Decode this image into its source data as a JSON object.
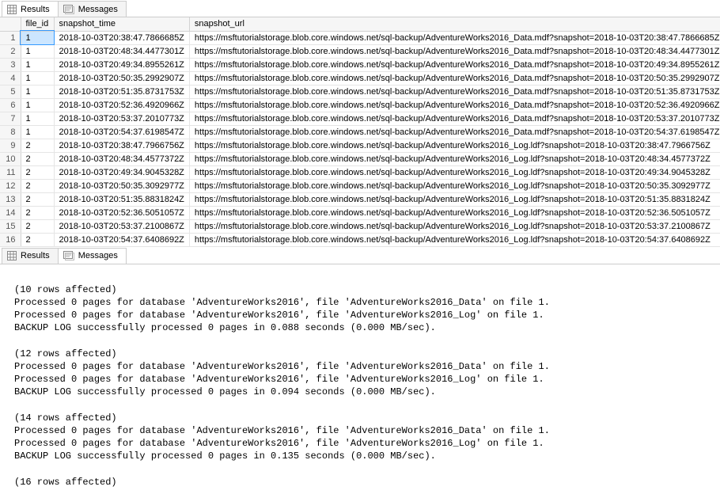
{
  "tabs_top": {
    "results": "Results",
    "messages": "Messages"
  },
  "tabs_bottom": {
    "results": "Results",
    "messages": "Messages"
  },
  "columns": {
    "file_id": "file_id",
    "snapshot_time": "snapshot_time",
    "snapshot_url": "snapshot_url"
  },
  "rows": [
    {
      "n": "1",
      "file_id": "1",
      "snapshot_time": "2018-10-03T20:38:47.7866685Z",
      "snapshot_url": "https://msftutorialstorage.blob.core.windows.net/sql-backup/AdventureWorks2016_Data.mdf?snapshot=2018-10-03T20:38:47.7866685Z"
    },
    {
      "n": "2",
      "file_id": "1",
      "snapshot_time": "2018-10-03T20:48:34.4477301Z",
      "snapshot_url": "https://msftutorialstorage.blob.core.windows.net/sql-backup/AdventureWorks2016_Data.mdf?snapshot=2018-10-03T20:48:34.4477301Z"
    },
    {
      "n": "3",
      "file_id": "1",
      "snapshot_time": "2018-10-03T20:49:34.8955261Z",
      "snapshot_url": "https://msftutorialstorage.blob.core.windows.net/sql-backup/AdventureWorks2016_Data.mdf?snapshot=2018-10-03T20:49:34.8955261Z"
    },
    {
      "n": "4",
      "file_id": "1",
      "snapshot_time": "2018-10-03T20:50:35.2992907Z",
      "snapshot_url": "https://msftutorialstorage.blob.core.windows.net/sql-backup/AdventureWorks2016_Data.mdf?snapshot=2018-10-03T20:50:35.2992907Z"
    },
    {
      "n": "5",
      "file_id": "1",
      "snapshot_time": "2018-10-03T20:51:35.8731753Z",
      "snapshot_url": "https://msftutorialstorage.blob.core.windows.net/sql-backup/AdventureWorks2016_Data.mdf?snapshot=2018-10-03T20:51:35.8731753Z"
    },
    {
      "n": "6",
      "file_id": "1",
      "snapshot_time": "2018-10-03T20:52:36.4920966Z",
      "snapshot_url": "https://msftutorialstorage.blob.core.windows.net/sql-backup/AdventureWorks2016_Data.mdf?snapshot=2018-10-03T20:52:36.4920966Z"
    },
    {
      "n": "7",
      "file_id": "1",
      "snapshot_time": "2018-10-03T20:53:37.2010773Z",
      "snapshot_url": "https://msftutorialstorage.blob.core.windows.net/sql-backup/AdventureWorks2016_Data.mdf?snapshot=2018-10-03T20:53:37.2010773Z"
    },
    {
      "n": "8",
      "file_id": "1",
      "snapshot_time": "2018-10-03T20:54:37.6198547Z",
      "snapshot_url": "https://msftutorialstorage.blob.core.windows.net/sql-backup/AdventureWorks2016_Data.mdf?snapshot=2018-10-03T20:54:37.6198547Z"
    },
    {
      "n": "9",
      "file_id": "2",
      "snapshot_time": "2018-10-03T20:38:47.7966756Z",
      "snapshot_url": "https://msftutorialstorage.blob.core.windows.net/sql-backup/AdventureWorks2016_Log.ldf?snapshot=2018-10-03T20:38:47.7966756Z"
    },
    {
      "n": "10",
      "file_id": "2",
      "snapshot_time": "2018-10-03T20:48:34.4577372Z",
      "snapshot_url": "https://msftutorialstorage.blob.core.windows.net/sql-backup/AdventureWorks2016_Log.ldf?snapshot=2018-10-03T20:48:34.4577372Z"
    },
    {
      "n": "11",
      "file_id": "2",
      "snapshot_time": "2018-10-03T20:49:34.9045328Z",
      "snapshot_url": "https://msftutorialstorage.blob.core.windows.net/sql-backup/AdventureWorks2016_Log.ldf?snapshot=2018-10-03T20:49:34.9045328Z"
    },
    {
      "n": "12",
      "file_id": "2",
      "snapshot_time": "2018-10-03T20:50:35.3092977Z",
      "snapshot_url": "https://msftutorialstorage.blob.core.windows.net/sql-backup/AdventureWorks2016_Log.ldf?snapshot=2018-10-03T20:50:35.3092977Z"
    },
    {
      "n": "13",
      "file_id": "2",
      "snapshot_time": "2018-10-03T20:51:35.8831824Z",
      "snapshot_url": "https://msftutorialstorage.blob.core.windows.net/sql-backup/AdventureWorks2016_Log.ldf?snapshot=2018-10-03T20:51:35.8831824Z"
    },
    {
      "n": "14",
      "file_id": "2",
      "snapshot_time": "2018-10-03T20:52:36.5051057Z",
      "snapshot_url": "https://msftutorialstorage.blob.core.windows.net/sql-backup/AdventureWorks2016_Log.ldf?snapshot=2018-10-03T20:52:36.5051057Z"
    },
    {
      "n": "15",
      "file_id": "2",
      "snapshot_time": "2018-10-03T20:53:37.2100867Z",
      "snapshot_url": "https://msftutorialstorage.blob.core.windows.net/sql-backup/AdventureWorks2016_Log.ldf?snapshot=2018-10-03T20:53:37.2100867Z"
    },
    {
      "n": "16",
      "file_id": "2",
      "snapshot_time": "2018-10-03T20:54:37.6408692Z",
      "snapshot_url": "https://msftutorialstorage.blob.core.windows.net/sql-backup/AdventureWorks2016_Log.ldf?snapshot=2018-10-03T20:54:37.6408692Z"
    }
  ],
  "messages": [
    "",
    "(10 rows affected)",
    "Processed 0 pages for database 'AdventureWorks2016', file 'AdventureWorks2016_Data' on file 1.",
    "Processed 0 pages for database 'AdventureWorks2016', file 'AdventureWorks2016_Log' on file 1.",
    "BACKUP LOG successfully processed 0 pages in 0.088 seconds (0.000 MB/sec).",
    "",
    "(12 rows affected)",
    "Processed 0 pages for database 'AdventureWorks2016', file 'AdventureWorks2016_Data' on file 1.",
    "Processed 0 pages for database 'AdventureWorks2016', file 'AdventureWorks2016_Log' on file 1.",
    "BACKUP LOG successfully processed 0 pages in 0.094 seconds (0.000 MB/sec).",
    "",
    "(14 rows affected)",
    "Processed 0 pages for database 'AdventureWorks2016', file 'AdventureWorks2016_Data' on file 1.",
    "Processed 0 pages for database 'AdventureWorks2016', file 'AdventureWorks2016_Log' on file 1.",
    "BACKUP LOG successfully processed 0 pages in 0.135 seconds (0.000 MB/sec).",
    "",
    "(16 rows affected)"
  ]
}
